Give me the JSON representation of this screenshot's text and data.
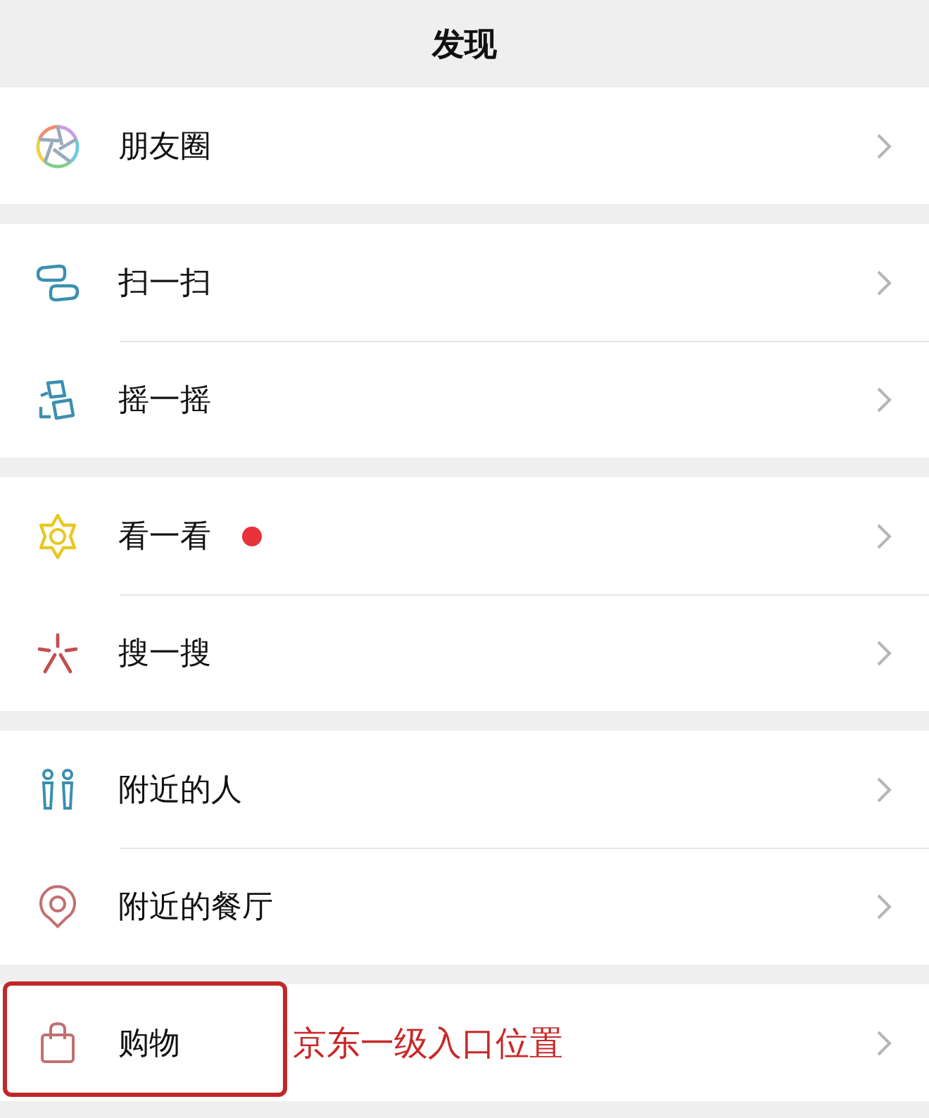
{
  "header": {
    "title": "发现"
  },
  "groups": [
    {
      "items": [
        {
          "kind": "moments",
          "label": "朋友圈",
          "badge": false,
          "highlighted": false
        }
      ]
    },
    {
      "items": [
        {
          "kind": "scan",
          "label": "扫一扫",
          "badge": false,
          "highlighted": false
        },
        {
          "kind": "shake",
          "label": "摇一摇",
          "badge": false,
          "highlighted": false
        }
      ]
    },
    {
      "items": [
        {
          "kind": "look",
          "label": "看一看",
          "badge": true,
          "highlighted": false
        },
        {
          "kind": "search",
          "label": "搜一搜",
          "badge": false,
          "highlighted": false
        }
      ]
    },
    {
      "items": [
        {
          "kind": "people",
          "label": "附近的人",
          "badge": false,
          "highlighted": false
        },
        {
          "kind": "restaurant",
          "label": "附近的餐厅",
          "badge": false,
          "highlighted": false
        }
      ]
    },
    {
      "items": [
        {
          "kind": "shop",
          "label": "购物",
          "badge": false,
          "highlighted": true,
          "note": "京东一级入口位置"
        }
      ]
    }
  ]
}
